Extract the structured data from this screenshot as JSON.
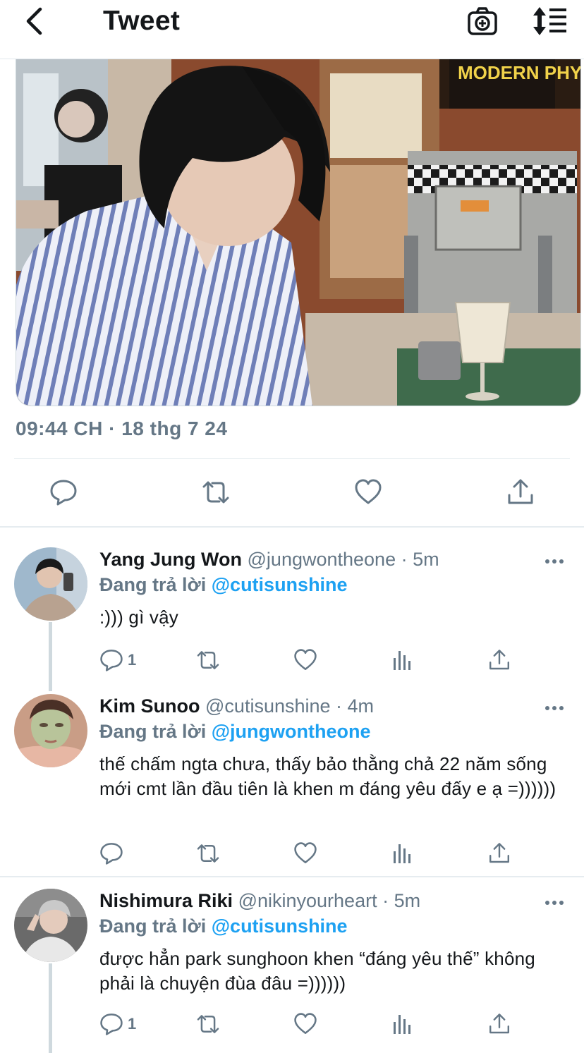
{
  "header": {
    "title": "Tweet",
    "back_icon": "chevron-left-icon",
    "camera_icon": "camera-icon",
    "sort_icon": "sort-icon"
  },
  "tweet": {
    "timestamp": "09:44 CH · 18 thg 7 24",
    "photo_sign_text": "MODERN PHYSICS"
  },
  "colors": {
    "accent": "#1da1f2",
    "secondary_text": "#657786",
    "divider": "#e6ecf0"
  },
  "replies": [
    {
      "name": "Yang Jung Won",
      "handle": "@jungwontheone",
      "time": " · 5m",
      "replying_prefix": "Đang trả lời ",
      "replying_to": "@cutisunshine",
      "text": ":))) gì vậy",
      "reply_count": "1"
    },
    {
      "name": "Kim Sunoo",
      "handle": "@cutisunshine",
      "time": " · 4m",
      "replying_prefix": "Đang trả lời ",
      "replying_to": "@jungwontheone",
      "text": "thế chấm ngta chưa, thấy bảo thằng chả 22 năm sống mới cmt lần đầu tiên là khen m đáng yêu đấy e ạ =))))))",
      "reply_count": ""
    },
    {
      "name": "Nishimura Riki",
      "handle": "@nikinyourheart",
      "time": " · 5m",
      "replying_prefix": "Đang trả lời ",
      "replying_to": "@cutisunshine",
      "text": "được hẳn park sunghoon khen “đáng yêu thế” không phải là chuyện đùa đâu =))))))",
      "reply_count": "1"
    }
  ]
}
